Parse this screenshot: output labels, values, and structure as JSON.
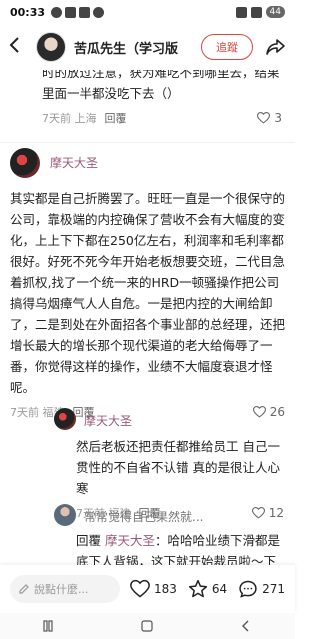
{
  "status": {
    "time": "00:33",
    "battery": "44"
  },
  "header": {
    "back_icon": "back-arrow-icon",
    "title": "苦瓜先生（学习版",
    "follow_label": "追蹤",
    "share_icon": "share-icon"
  },
  "previous_comment": {
    "text": "时的放过注意，获为难吃不到哪里去，结果里面一半都没吃下去（）",
    "time_location": "7天前 上海",
    "reply_label": "回覆",
    "likes": "3"
  },
  "comments": [
    {
      "author": "摩天大圣",
      "text": "其实都是自己折腾罢了。旺旺一直是一个很保守的公司，靠极端的内控确保了营收不会有大幅度的变化，上上下下都在250亿左右，利润率和毛利率都很好。好死不死今年开始老板想要交班，二代目急着抓权,找了一个统一来的HRD一顿骚操作把公司搞得乌烟瘴气人人自危。一是把内控的大闸给卸了，二是到处在外面招各个事业部的总经理，还把增长最大的增长那个现代渠道的老大给侮辱了一番，你觉得这样的操作，业绩不大幅度衰退才怪呢。",
      "time_location": "7天前 福建",
      "reply_label": "回覆",
      "likes": "26"
    },
    {
      "author": "摩天大圣",
      "text": "然后老板还把责任都推给员工 自己一贯性的不自省不认错 真的是很让人心寒",
      "time_location": "7天前 福建",
      "reply_label": "回覆",
      "likes": "12"
    },
    {
      "author": "常常觉得自己果然就...",
      "reply_tag": "回覆",
      "reply_to": "摩天大圣",
      "text": "哈哈哈业绩下滑都是底下人背锅，这下就开始裁员啦～下一部"
    }
  ],
  "bottom": {
    "input_placeholder": "說點什麼...",
    "likes": "183",
    "favorites": "64",
    "comments": "271"
  }
}
